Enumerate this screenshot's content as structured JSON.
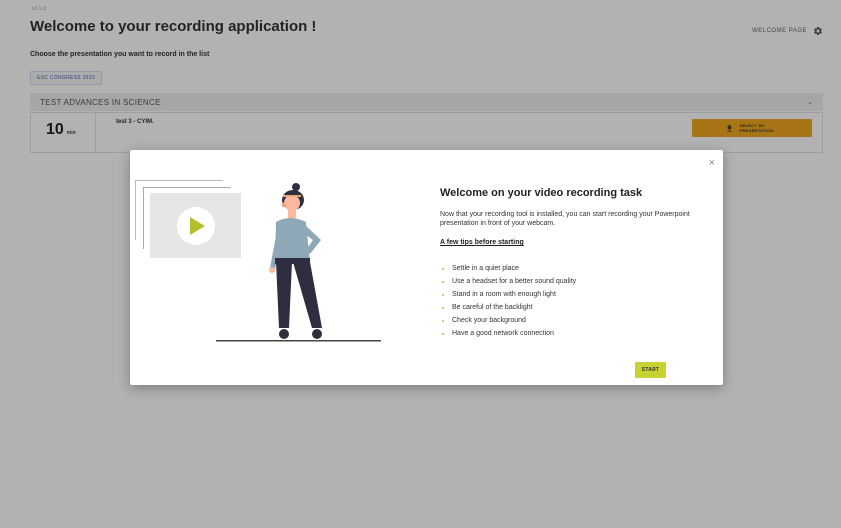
{
  "app": {
    "version": "v1.1.0",
    "title": "Welcome to your recording application !",
    "welcome_link": "WELCOME PAGE",
    "subtitle": "Choose the presentation you want to record in the list",
    "congress_chip": "ESC CONGRESS 2020"
  },
  "section": {
    "title": "TEST ADVANCES IN SCIENCE",
    "items": [
      {
        "duration_value": "10",
        "duration_unit": "min",
        "title": "test 3 - CYIM.",
        "button_label": "SELECT MY PRESENTATION"
      }
    ]
  },
  "modal": {
    "close_symbol": "×",
    "title": "Welcome on your video recording task",
    "intro": "Now that your recording tool is installed, you can start recording your Powerpoint presentation in front of your webcam.",
    "tips_heading": "A few tips before starting",
    "tips": [
      "Settle in a quiet place",
      "Use a headset for a better sound quality",
      "Stand in a room with enough light",
      "Be careful of the backlight",
      "Check your background",
      "Have a good network connection"
    ],
    "start_label": "START"
  },
  "colors": {
    "accent_orange": "#f0a820",
    "accent_lime": "#c8d233",
    "overlay": "rgba(0,0,0,0.3)"
  },
  "icons": {
    "settings": "gear-icon",
    "download": "download-icon",
    "collapse": "chevron-down-icon",
    "close": "close-icon",
    "play": "play-icon"
  }
}
